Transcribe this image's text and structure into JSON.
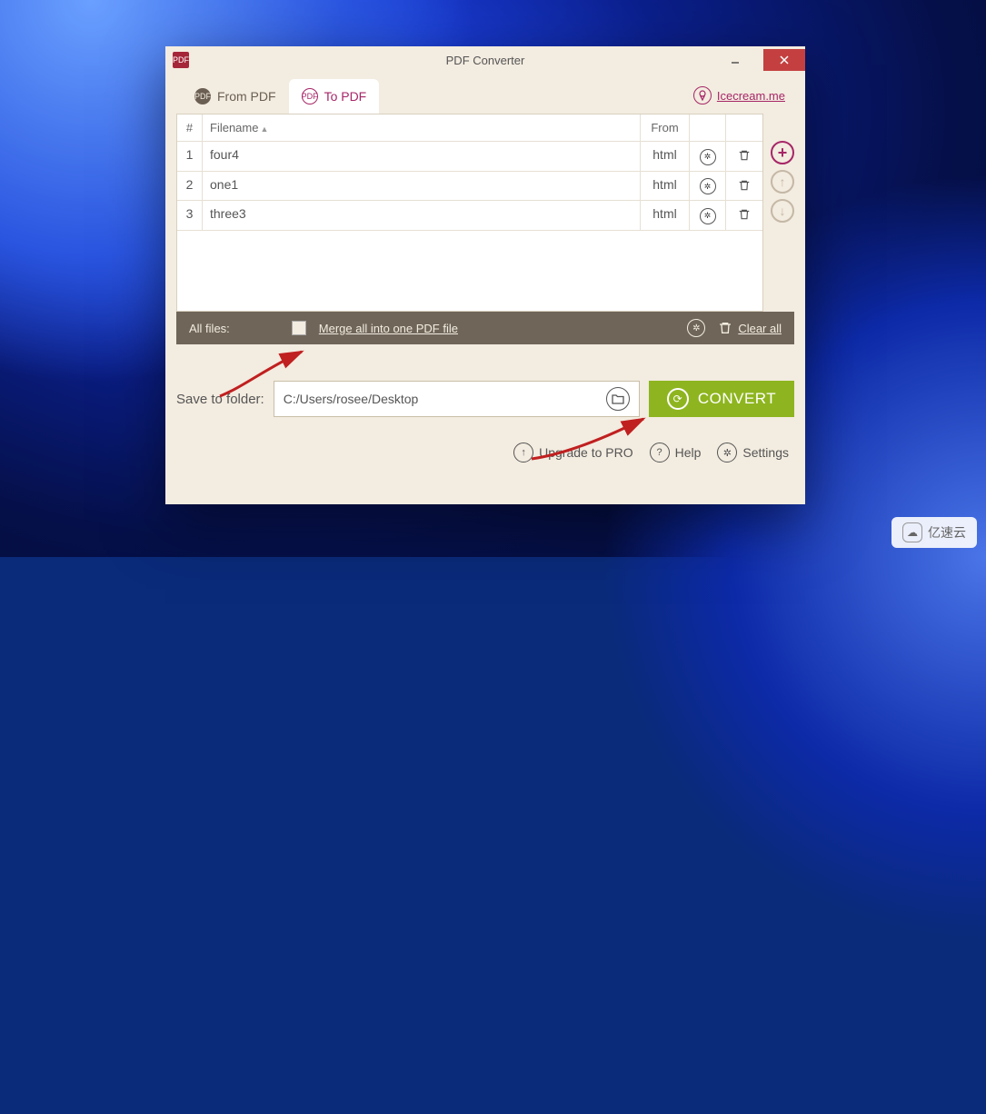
{
  "title": "PDF Converter",
  "tabs": {
    "from_pdf": "From PDF",
    "to_pdf": "To PDF"
  },
  "brand": "Icecream.me",
  "table": {
    "headers": {
      "num": "#",
      "filename": "Filename",
      "from": "From"
    },
    "rows": [
      {
        "num": "1",
        "name": "four4",
        "from": "html"
      },
      {
        "num": "2",
        "name": "one1",
        "from": "html"
      },
      {
        "num": "3",
        "name": "three3",
        "from": "html"
      }
    ]
  },
  "toolbar": {
    "all_files": "All files:",
    "merge": "Merge all into one PDF file",
    "clear_all": "Clear all"
  },
  "save": {
    "label": "Save to folder:",
    "path": "C:/Users/rosee/Desktop"
  },
  "convert": "CONVERT",
  "footer": {
    "upgrade": "Upgrade to PRO",
    "help": "Help",
    "settings": "Settings"
  },
  "watermark": "亿速云"
}
